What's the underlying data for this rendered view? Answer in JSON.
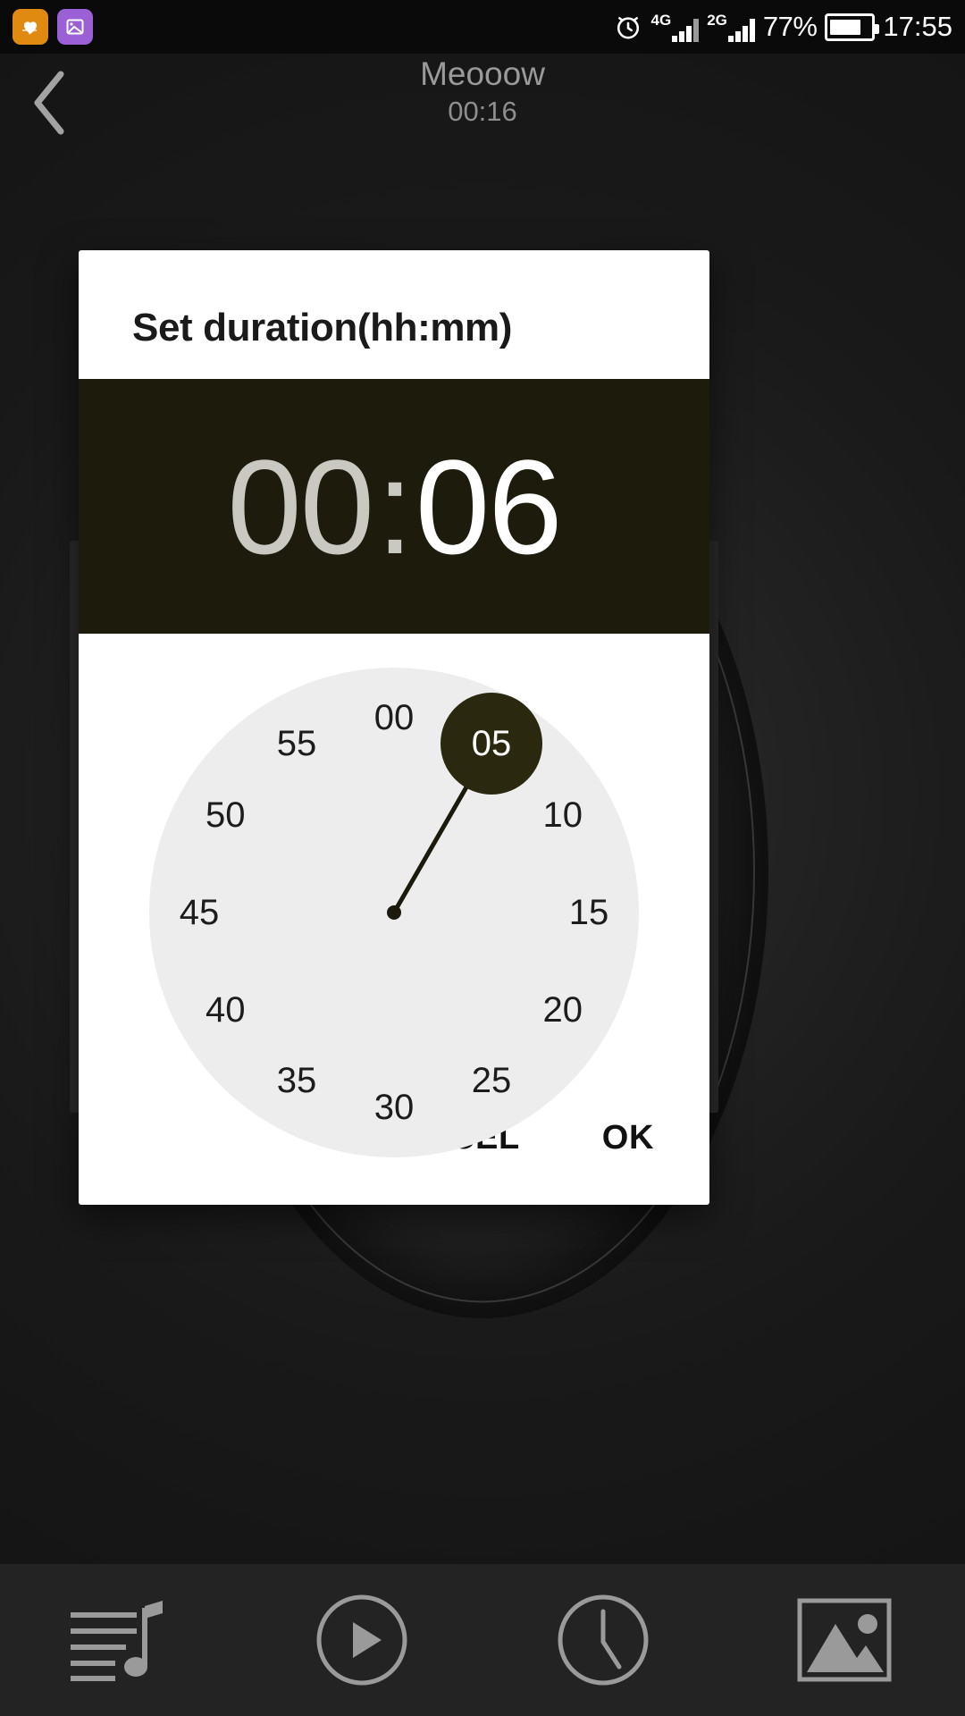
{
  "status_bar": {
    "notifications": [
      {
        "name": "health-app-icon",
        "glyph": "♥",
        "color": "#e08a12"
      },
      {
        "name": "gallery-app-icon",
        "glyph": "▨",
        "color": "#9b5fd6"
      }
    ],
    "alarm_icon": "alarm-clock-icon",
    "sim1_network": "4G",
    "sim2_network": "2G",
    "battery_percent": "77%",
    "clock": "17:55"
  },
  "app_header": {
    "back_icon": "back-chevron-icon",
    "track_title": "Meooow",
    "track_time": "00:16"
  },
  "dialog": {
    "title": "Set duration(hh:mm)",
    "time": {
      "hours": "00",
      "separator": ":",
      "minutes": "06"
    },
    "clock": {
      "mode": "minutes",
      "selected_value": "05",
      "selected_angle_deg": 30,
      "numbers": [
        "00",
        "05",
        "10",
        "15",
        "20",
        "25",
        "30",
        "35",
        "40",
        "45",
        "50",
        "55"
      ],
      "face_color": "#ededed",
      "selector_color": "#2b2810"
    },
    "buttons": {
      "cancel": "CANCEL",
      "ok": "OK"
    }
  },
  "bottom_nav": {
    "items": [
      {
        "name": "playlist-music-icon",
        "label": "Playlist"
      },
      {
        "name": "play-circle-icon",
        "label": "Play"
      },
      {
        "name": "clock-timer-icon",
        "label": "Timer"
      },
      {
        "name": "image-gallery-icon",
        "label": "Gallery"
      }
    ]
  }
}
